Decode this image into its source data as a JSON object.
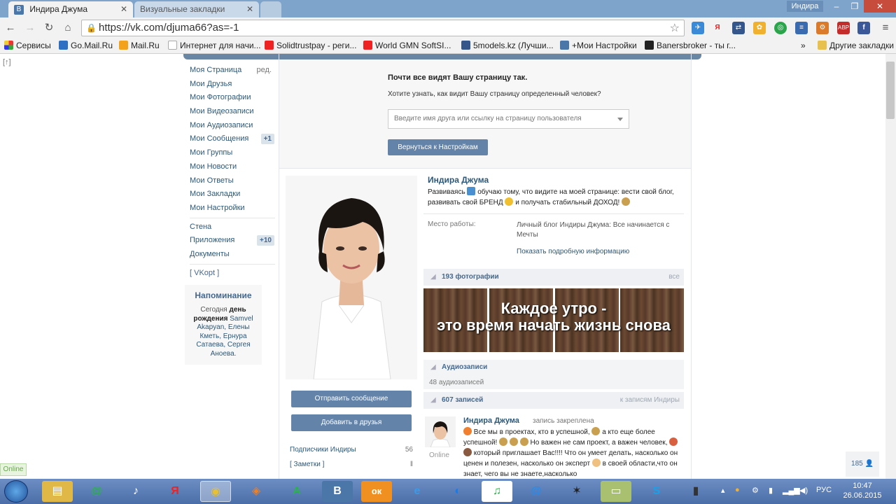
{
  "browser": {
    "tabs": [
      {
        "title": "Индира Джума",
        "favicon": "В",
        "active": true
      },
      {
        "title": "Визуальные закладки",
        "active": false
      }
    ],
    "user_badge": "Индира",
    "url": "https://vk.com/djuma66?as=-1",
    "extensions_badges": {
      "yandex": "Я",
      "abp": "ABP",
      "facebook": "f"
    },
    "bookmarks": [
      "Сервисы",
      "Go.Mail.Ru",
      "Mail.Ru",
      "Интернет для начи...",
      "Solidtrustpay - реги...",
      "World GMN SoftSI...",
      "5models.kz (Лучши...",
      "+Мои Настройки",
      "Banersbroker - ты г..."
    ],
    "bookmarks_overflow": "»",
    "other_bookmarks": "Другие закладки"
  },
  "page": {
    "corner_mark": "[↑]",
    "sidebar": {
      "items": [
        {
          "label": "Моя Страница",
          "extra": "ред."
        },
        {
          "label": "Мои Друзья"
        },
        {
          "label": "Мои Фотографии"
        },
        {
          "label": "Мои Видеозаписи"
        },
        {
          "label": "Мои Аудиозаписи"
        },
        {
          "label": "Мои Сообщения",
          "count": "+1"
        },
        {
          "label": "Мои Группы"
        },
        {
          "label": "Мои Новости"
        },
        {
          "label": "Мои Ответы"
        },
        {
          "label": "Мои Закладки"
        },
        {
          "label": "Мои Настройки"
        }
      ],
      "items2": [
        {
          "label": "Стена"
        },
        {
          "label": "Приложения",
          "count": "+10"
        },
        {
          "label": "Документы"
        }
      ],
      "vkopt": "[ VKopt ]"
    },
    "reminder": {
      "title": "Напоминание",
      "text_before": "Сегодня",
      "bold": "день рождения",
      "names": "Samvel Akapyan, Елены Кметь, Ернура Сатаева, Сергея Аноева."
    },
    "notice": {
      "title": "Почти все видят Вашу страницу так.",
      "question": "Хотите узнать, как видит Вашу страницу определенный человек?",
      "input_placeholder": "Введите имя друга или ссылку на страницу пользователя",
      "back_button": "Вернуться к Настройкам"
    },
    "profile": {
      "name": "Индира Джума",
      "status_1": "Развиваясь",
      "status_2": "обучаю тому, что видите на моей странице: вести свой блог, развивать свой БРЕНД",
      "status_3": "и получать стабильный ДОХОД!",
      "work_label": "Место работы:",
      "work_value": "Личный блог Индиры Джума: Все начинается с Мечты",
      "more_info": "Показать подробную информацию"
    },
    "buttons": {
      "send_message": "Отправить сообщение",
      "add_friend": "Добавить в друзья"
    },
    "subscribers": {
      "label": "Подписчики Индиры",
      "count": "56"
    },
    "notes": {
      "label": "[ Заметки ]",
      "count": "‖"
    },
    "photos": {
      "header": "193 фотографии",
      "all": "все",
      "banner_line1": "Каждое утро -",
      "banner_line2": "это время начать жизнь снова"
    },
    "audio": {
      "header": "Аудиозаписи",
      "count": "48 аудиозаписей"
    },
    "wall": {
      "header": "607 записей",
      "to_posts": "к записям Индиры"
    },
    "post": {
      "author": "Индира Джума",
      "pinned": "запись закреплена",
      "online": "Online",
      "text_1": "Все мы в проектах, кто в успешной,",
      "text_2": "а кто еще более успешной!",
      "text_3": "Но важен не сам проект, а важен человек,",
      "text_4": "который приглашает Вас!!!! Что он умеет делать, насколько он ценен и полезен, насколько он эксперт",
      "text_5": "в своей области,что он знает, чего вы не знаете,насколько"
    },
    "right_counter": "185",
    "online_badge": "Online"
  },
  "taskbar": {
    "apps": [
      "@",
      "♪",
      "Я",
      "◉",
      "◈",
      "A",
      "В",
      "ок",
      "e",
      "◐",
      "♫",
      "@",
      "✶",
      "▭",
      "S",
      "▮"
    ],
    "language": "РУС",
    "time": "10:47",
    "date": "26.06.2015"
  },
  "colors": {
    "vk_blue": "#6383a8",
    "vk_link": "#2b587a",
    "chrome_frame": "#7fa4cc"
  }
}
